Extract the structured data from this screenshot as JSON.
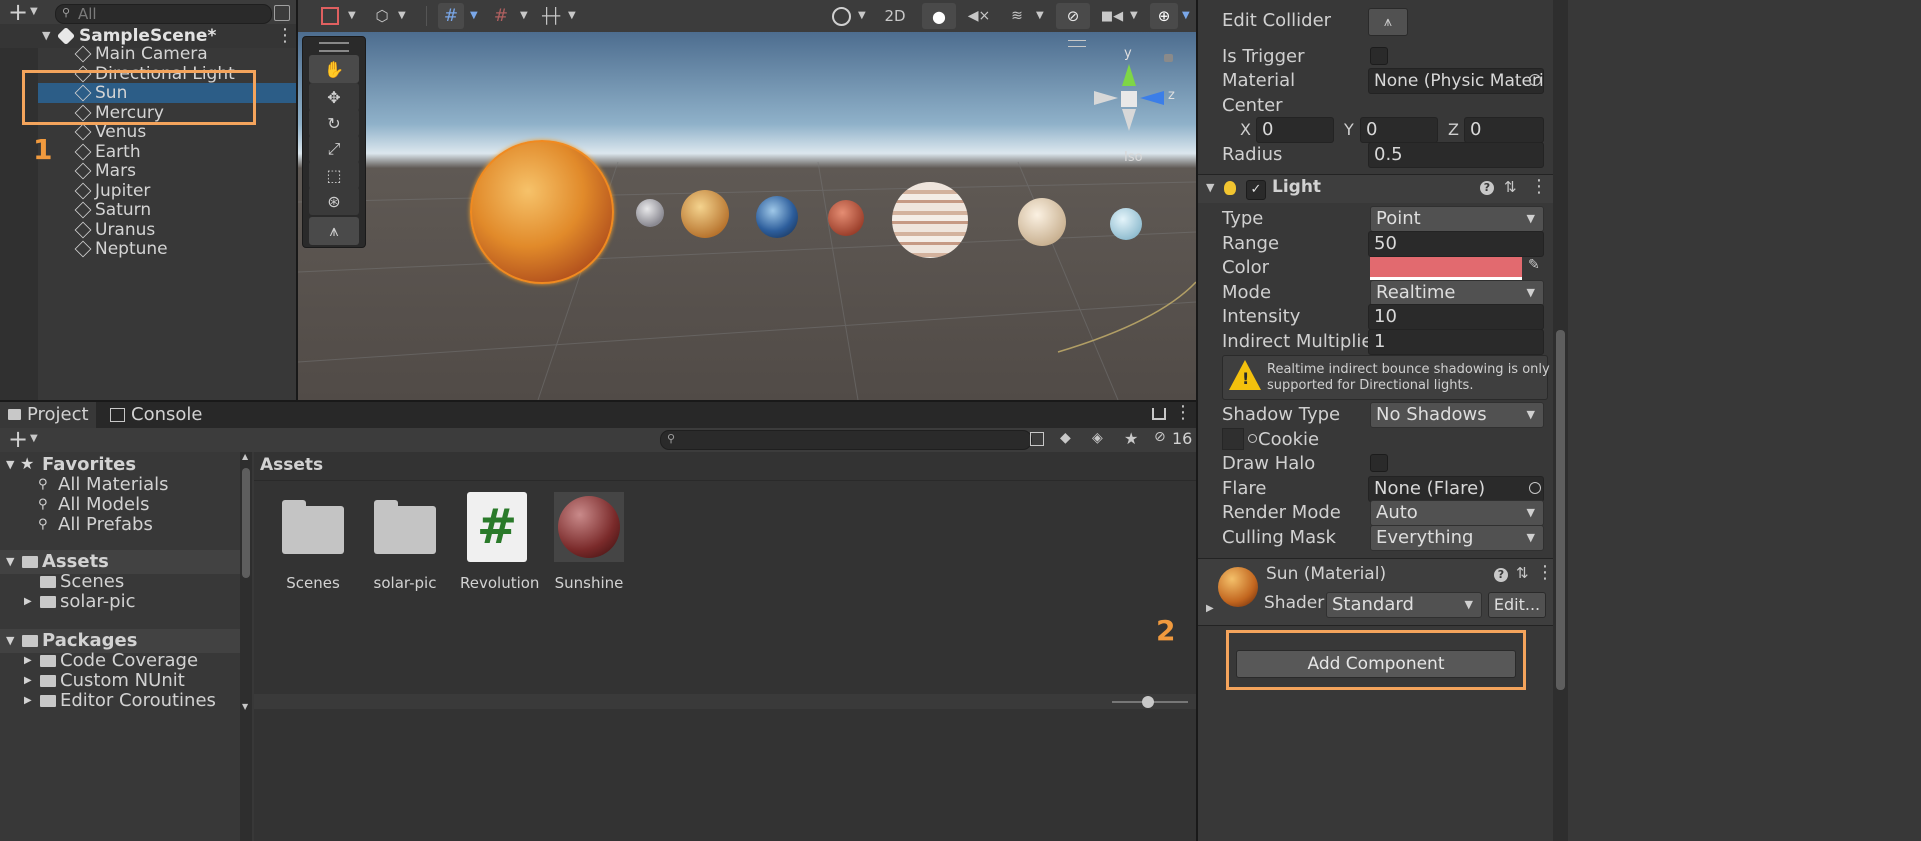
{
  "hierarchy": {
    "search_placeholder": "All",
    "scene_name": "SampleScene*",
    "items": [
      "Main Camera",
      "Directional Light",
      "Sun",
      "Mercury",
      "Venus",
      "Earth",
      "Mars",
      "Jupiter",
      "Saturn",
      "Uranus",
      "Neptune"
    ],
    "selected": "Sun"
  },
  "annotations": {
    "one": "1",
    "two": "2"
  },
  "scene_toolbar": {
    "mode_2d": "2D"
  },
  "gizmo": {
    "y": "y",
    "z": "z",
    "iso": "Iso"
  },
  "project": {
    "tab_project": "Project",
    "tab_console": "Console",
    "hidden_count": "16",
    "favorites_label": "Favorites",
    "favorites": [
      "All Materials",
      "All Models",
      "All Prefabs"
    ],
    "assets_label": "Assets",
    "assets_children": [
      "Scenes",
      "solar-pic"
    ],
    "packages_label": "Packages",
    "packages_children": [
      "Code Coverage",
      "Custom NUnit",
      "Editor Coroutines"
    ],
    "breadcrumb": "Assets",
    "grid_items": [
      "Scenes",
      "solar-pic",
      "Revolution",
      "Sunshine"
    ]
  },
  "inspector": {
    "collider": {
      "edit_collider": "Edit Collider",
      "is_trigger": "Is Trigger",
      "material_label": "Material",
      "material_value": "None (Physic Materia",
      "center_label": "Center",
      "x_label": "X",
      "x": "0",
      "y_label": "Y",
      "y": "0",
      "z_label": "Z",
      "z": "0",
      "radius_label": "Radius",
      "radius": "0.5"
    },
    "light": {
      "title": "Light",
      "type_label": "Type",
      "type": "Point",
      "range_label": "Range",
      "range": "50",
      "color_label": "Color",
      "color": "#e26a6f",
      "mode_label": "Mode",
      "mode": "Realtime",
      "intensity_label": "Intensity",
      "intensity": "10",
      "indirect_label": "Indirect Multiplier",
      "indirect": "1",
      "warning_line1": "Realtime indirect bounce shadowing is only",
      "warning_line2": "supported for Directional lights.",
      "shadow_label": "Shadow Type",
      "shadow": "No Shadows",
      "cookie_label": "Cookie",
      "halo_label": "Draw Halo",
      "flare_label": "Flare",
      "flare": "None (Flare)",
      "render_label": "Render Mode",
      "render": "Auto",
      "culling_label": "Culling Mask",
      "culling": "Everything"
    },
    "material": {
      "name": "Sun (Material)",
      "shader_label": "Shader",
      "shader": "Standard",
      "edit": "Edit..."
    },
    "add_component": "Add Component"
  },
  "colors": {
    "highlight": "#f4a45c",
    "selection": "#2c5d87",
    "annotation": "#f19a3e"
  }
}
